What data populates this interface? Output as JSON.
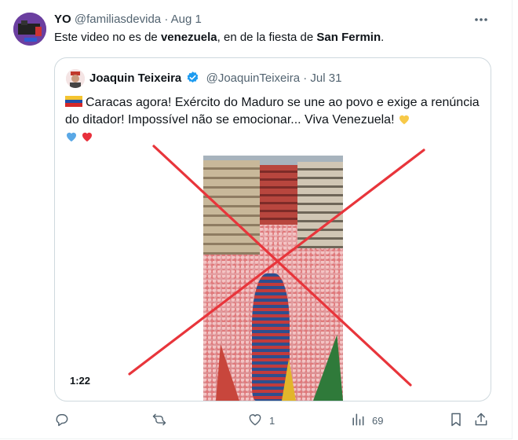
{
  "post": {
    "author_name": "YO",
    "handle": "@familiasdevida",
    "separator": "·",
    "date": "Aug 1",
    "text_parts": [
      {
        "t": "Este video no es de ",
        "b": false
      },
      {
        "t": "venezuela",
        "b": true
      },
      {
        "t": ", en de la fiesta de ",
        "b": false
      },
      {
        "t": "San Fermin",
        "b": true
      },
      {
        "t": ".",
        "b": false
      }
    ],
    "more_icon": "ellipsis-icon"
  },
  "quoted": {
    "author_name": "Joaquin Teixeira",
    "verified_icon": "verified-badge-icon",
    "handle": "@JoaquinTeixeira",
    "separator": "·",
    "date": "Jul 31",
    "flag_icon": "venezuela-flag-icon",
    "text": "Caracas agora! Exército do Maduro se une ao povo e exige a renúncia do ditador! Impossível não se emocionar... Viva Venezuela!",
    "emoji_icons": [
      "yellow-heart-icon",
      "blue-heart-icon",
      "red-heart-icon"
    ],
    "video": {
      "duration": "1:22",
      "overlay_icon": "red-x-overlay-icon"
    }
  },
  "actions": {
    "reply": {
      "icon": "reply-icon",
      "count": ""
    },
    "repost": {
      "icon": "repost-icon",
      "count": ""
    },
    "like": {
      "icon": "heart-icon",
      "count": "1"
    },
    "views": {
      "icon": "views-chart-icon",
      "count": "69"
    },
    "bookmark": {
      "icon": "bookmark-icon"
    },
    "share": {
      "icon": "share-icon"
    }
  },
  "colors": {
    "text": "#0f1419",
    "muted": "#536471",
    "border": "#cfd9de",
    "verified": "#1d9bf0",
    "overlay_x": "#e8353b"
  }
}
